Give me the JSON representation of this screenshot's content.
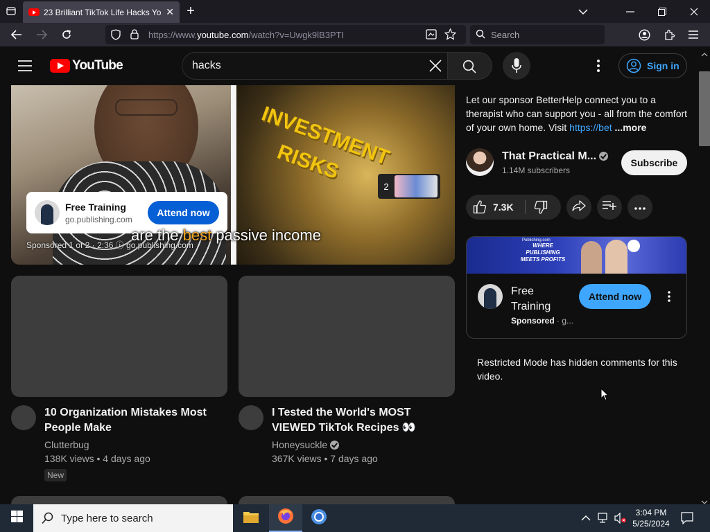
{
  "browser": {
    "tab_title": "23 Brilliant TikTok Life Hacks You...",
    "url_prefix": "https://www.",
    "url_domain": "youtube.com",
    "url_path": "/watch?v=Uwgk9lB3PTI",
    "search_placeholder": "Search",
    "new_tab_label": "+"
  },
  "youtube": {
    "logo_text": "YouTube",
    "search_value": "hacks",
    "sign_in_label": "Sign in"
  },
  "player": {
    "invest_line1": "INVESTMENT",
    "invest_line2": "RISKS",
    "ad_card_title": "Free Training",
    "ad_card_domain": "go.publishing.com",
    "ad_card_button": "Attend now",
    "caption_pre": "are the ",
    "caption_hl": "best",
    "caption_post": " passive income",
    "sponsor_line": "Sponsored 1 of 2 · 2:36 ⓘ   go.publishing.com",
    "next_number": "2",
    "progress_fraction": 0.006
  },
  "related": [
    {
      "title": "10 Organization Mistakes Most People Make",
      "channel": "Clutterbug",
      "verified": false,
      "meta": "138K views • 4 days ago",
      "badge": "New"
    },
    {
      "title": "I Tested the World's MOST VIEWED TikTok Recipes 👀",
      "channel": "Honeysuckle",
      "verified": true,
      "meta": "367K views • 7 days ago",
      "badge": ""
    }
  ],
  "description": {
    "text": "Let our sponsor BetterHelp connect you to a therapist who can support you - all from the comfort of your own home. Visit ",
    "link": "https://bet",
    "more": "...more"
  },
  "channel": {
    "name": "That Practical M...",
    "subscribers": "1.14M subscribers",
    "subscribe_label": "Subscribe"
  },
  "actions": {
    "like_count": "7.3K"
  },
  "sidebar_ad": {
    "banner_brand": "Publishing.com",
    "banner_text": "WHERE PUBLISHING MEETS PROFITS",
    "title": "Free Training",
    "sponsored": "Sponsored",
    "sponsored_suffix": " · g...",
    "button": "Attend now"
  },
  "comments_notice": "Restricted Mode has hidden comments for this video.",
  "taskbar": {
    "search_placeholder": "Type here to search",
    "time": "3:04 PM",
    "date": "5/25/2024"
  },
  "colors": {
    "yt_red": "#ff0000",
    "link_blue": "#3ea6ff",
    "cta_blue": "#065fd4",
    "caption_highlight": "#f5a623"
  }
}
